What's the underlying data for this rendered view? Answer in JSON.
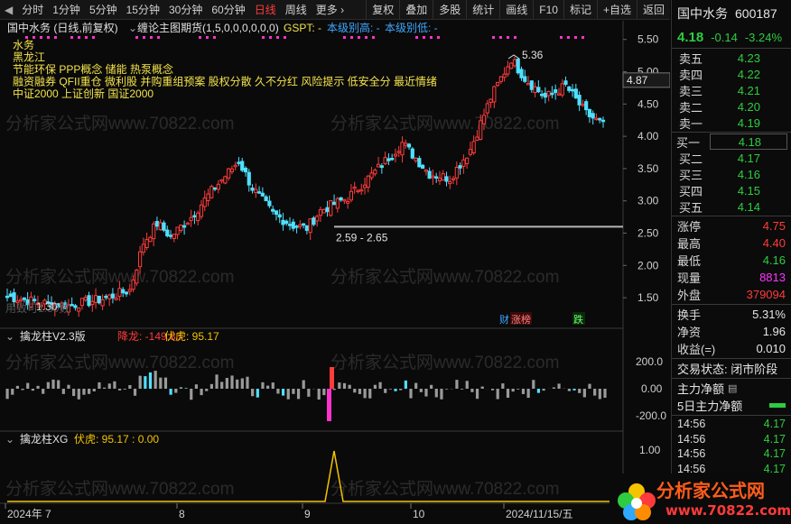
{
  "topbar": {
    "back_symbol": "◀",
    "periods": [
      "分时",
      "1分钟",
      "5分钟",
      "15分钟",
      "30分钟",
      "60分钟",
      "日线",
      "周线",
      "更多 ›"
    ],
    "active_period": "日线",
    "tools": [
      "复权",
      "叠加",
      "多股",
      "统计",
      "画线",
      "F10",
      "标记",
      "+自选",
      "返回"
    ]
  },
  "main": {
    "title": "国中水务 (日线,前复权)",
    "indicator_name": "缠论主图期货(1,5,0,0,0,0,0,0)",
    "indicator_params": "GSPT: -",
    "high_label": "本级别高: -",
    "low_label": "本级别低: -",
    "concepts": [
      "水务",
      "黑龙江",
      "节能环保 PPP概念 储能 热泵概念",
      "融资融券 QFII重仓 微利股 并购重组预案 股权分散 久不分红 风险提示 低安全分 最近情绪",
      "中证2000 上证创新 国证2000"
    ],
    "hi_annot": "5.36",
    "lo_annot": "1.30",
    "range_annot": "2.59 - 2.65",
    "bottom_note": "用致可1.30数",
    "price_ticks": [
      "5.50",
      "5.00",
      "4.50",
      "4.00",
      "3.50",
      "3.00",
      "2.50",
      "2.00",
      "1.50"
    ],
    "current_price": "4.87",
    "tags": [
      "财",
      "涨榜",
      "跌"
    ],
    "watermark": "分析家公式网www.70822.com"
  },
  "sub1": {
    "title": "擒龙柱V2.3版",
    "label_a": "降龙: -149.83",
    "label_b": "伏虎: 95.17",
    "ticks": [
      "200.0",
      "0.00",
      "-200.0"
    ]
  },
  "sub2": {
    "title": "擒龙柱XG",
    "label_a": "伏虎: 95.17 : 0.00",
    "ticks": [
      "1.00"
    ]
  },
  "xaxis": [
    "2024年 7",
    "8",
    "9",
    "10",
    "2024/11/15/五"
  ],
  "colors": {
    "up": "#ff3b3b",
    "down": "#4fe0ff",
    "neutral": "#9a9a9a",
    "magenta": "#ff33cc",
    "yellow": "#f3c300",
    "green": "#2ecc40"
  },
  "side": {
    "stock_name": "国中水务",
    "code": "600187",
    "price": "4.18",
    "change": "-0.14",
    "pct": "-3.24%",
    "asks": [
      {
        "label": "卖五",
        "price": "4.23"
      },
      {
        "label": "卖四",
        "price": "4.22"
      },
      {
        "label": "卖三",
        "price": "4.21"
      },
      {
        "label": "卖二",
        "price": "4.20"
      },
      {
        "label": "卖一",
        "price": "4.19"
      }
    ],
    "bids": [
      {
        "label": "买一",
        "price": "4.18"
      },
      {
        "label": "买二",
        "price": "4.17"
      },
      {
        "label": "买三",
        "price": "4.16"
      },
      {
        "label": "买四",
        "price": "4.15"
      },
      {
        "label": "买五",
        "price": "4.14"
      }
    ],
    "limit_up_label": "涨停",
    "limit_up": "4.75",
    "limit_down_label": "跌停",
    "high_label": "最高",
    "high": "4.40",
    "low_label": "最低",
    "low": "4.16",
    "vol_label": "现量",
    "vol": "8813",
    "outer_label": "外盘",
    "outer": "379094",
    "turnover_label": "换手",
    "turnover": "5.31%",
    "nav_label": "净资",
    "nav": "1.96",
    "eps_label": "收益(=)",
    "eps": "0.010",
    "status": "交易状态: 闭市阶段",
    "main_flow": "主力净额",
    "main_flow5": "5日主力净额",
    "ticks": [
      {
        "t": "14:56",
        "p": "4.17"
      },
      {
        "t": "14:56",
        "p": "4.17"
      },
      {
        "t": "14:56",
        "p": "4.17"
      },
      {
        "t": "14:56",
        "p": "4.17"
      }
    ]
  },
  "logo": {
    "text": "分析家公式网",
    "url": "www.70822.com"
  }
}
